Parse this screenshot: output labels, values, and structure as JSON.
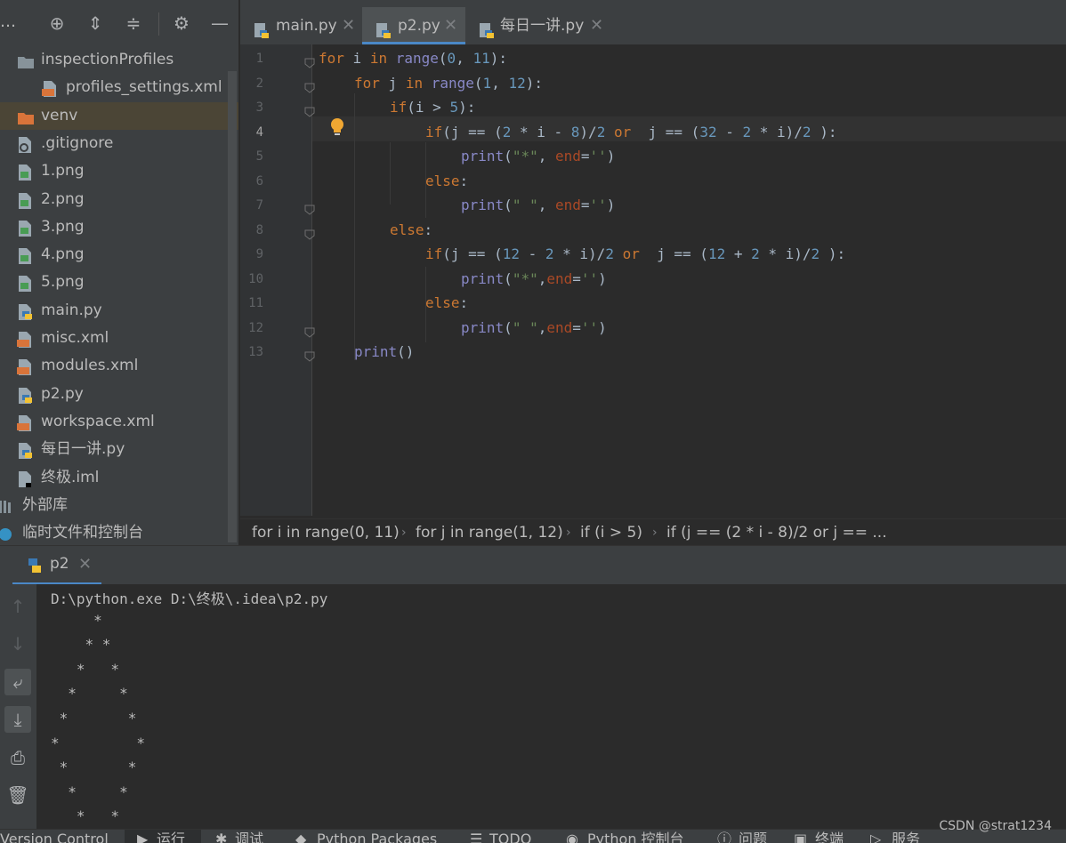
{
  "sidebar": {
    "toolbar_icons": [
      "locate-icon",
      "expand-all-icon",
      "collapse-all-icon",
      "gear-icon",
      "minimize-icon"
    ],
    "tree": [
      {
        "label": "inspectionProfiles",
        "icon": "folder-icon",
        "indent": 1
      },
      {
        "label": "profiles_settings.xml",
        "icon": "xml-file-icon",
        "indent": 2
      },
      {
        "label": "venv",
        "icon": "folder-excluded-icon",
        "indent": 1,
        "selected": true
      },
      {
        "label": ".gitignore",
        "icon": "ignore-file-icon",
        "indent": 1
      },
      {
        "label": "1.png",
        "icon": "image-file-icon",
        "indent": 1
      },
      {
        "label": "2.png",
        "icon": "image-file-icon",
        "indent": 1
      },
      {
        "label": "3.png",
        "icon": "image-file-icon",
        "indent": 1
      },
      {
        "label": "4.png",
        "icon": "image-file-icon",
        "indent": 1
      },
      {
        "label": "5.png",
        "icon": "image-file-icon",
        "indent": 1
      },
      {
        "label": "main.py",
        "icon": "python-file-icon",
        "indent": 1
      },
      {
        "label": "misc.xml",
        "icon": "xml-file-icon",
        "indent": 1
      },
      {
        "label": "modules.xml",
        "icon": "xml-file-icon",
        "indent": 1
      },
      {
        "label": "p2.py",
        "icon": "python-file-icon",
        "indent": 1
      },
      {
        "label": "workspace.xml",
        "icon": "xml-file-icon",
        "indent": 1
      },
      {
        "label": "每日一讲.py",
        "icon": "python-file-icon",
        "indent": 1
      },
      {
        "label": "终极.iml",
        "icon": "iml-file-icon",
        "indent": 1
      },
      {
        "label": "外部库",
        "icon": "library-icon",
        "indent": 0
      },
      {
        "label": "临时文件和控制台",
        "icon": "scratches-icon",
        "indent": 0
      }
    ]
  },
  "tabs": [
    {
      "label": "main.py",
      "active": false
    },
    {
      "label": "p2.py",
      "active": true
    },
    {
      "label": "每日一讲.py",
      "active": false
    }
  ],
  "editor": {
    "current_line": 4,
    "lines": [
      {
        "no": "1",
        "tokens": [
          [
            "kw",
            "for"
          ],
          [
            "",
            "i"
          ],
          [
            "kw",
            "in"
          ],
          [
            "builtin",
            "range"
          ],
          [
            "",
            "("
          ],
          [
            "num",
            "0"
          ],
          [
            "",
            ", "
          ],
          [
            "num",
            "11"
          ],
          [
            "",
            "):"
          ]
        ],
        "indent": 0
      },
      {
        "no": "2",
        "tokens": [
          [
            "kw",
            "for"
          ],
          [
            "",
            "j"
          ],
          [
            "kw",
            "in"
          ],
          [
            "builtin",
            "range"
          ],
          [
            "",
            "("
          ],
          [
            "num",
            "1"
          ],
          [
            "",
            ", "
          ],
          [
            "num",
            "12"
          ],
          [
            "",
            "):"
          ]
        ],
        "indent": 1
      },
      {
        "no": "3",
        "tokens": [
          [
            "kw",
            "if"
          ],
          [
            "",
            "(i > "
          ],
          [
            "num",
            "5"
          ],
          [
            "",
            "):"
          ]
        ],
        "indent": 2
      },
      {
        "no": "4",
        "tokens": [
          [
            "kw",
            "if"
          ],
          [
            "",
            "(j == ("
          ],
          [
            "num",
            "2"
          ],
          [
            "",
            " * i - "
          ],
          [
            "num",
            "8"
          ],
          [
            "",
            ")/"
          ],
          [
            "num",
            "2"
          ],
          [
            "",
            " "
          ],
          [
            "kw",
            "or"
          ],
          [
            "",
            " j == ("
          ],
          [
            "num",
            "32"
          ],
          [
            "",
            " - "
          ],
          [
            "num",
            "2"
          ],
          [
            "",
            " * i)/"
          ],
          [
            "num",
            "2"
          ],
          [
            "",
            " ):"
          ]
        ],
        "indent": 3
      },
      {
        "no": "5",
        "tokens": [
          [
            "builtin",
            "print"
          ],
          [
            "",
            "("
          ],
          [
            "str",
            "\"*\""
          ],
          [
            "",
            ", "
          ],
          [
            "named",
            "end"
          ],
          [
            "",
            "="
          ],
          [
            "str",
            "''"
          ],
          [
            "",
            ")"
          ]
        ],
        "indent": 4
      },
      {
        "no": "6",
        "tokens": [
          [
            "kw",
            "else"
          ],
          [
            "",
            ":"
          ]
        ],
        "indent": 3
      },
      {
        "no": "7",
        "tokens": [
          [
            "builtin",
            "print"
          ],
          [
            "",
            "("
          ],
          [
            "str",
            "\" \""
          ],
          [
            "",
            ", "
          ],
          [
            "named",
            "end"
          ],
          [
            "",
            "="
          ],
          [
            "str",
            "''"
          ],
          [
            "",
            ")"
          ]
        ],
        "indent": 4
      },
      {
        "no": "8",
        "tokens": [
          [
            "kw",
            "else"
          ],
          [
            "",
            ":"
          ]
        ],
        "indent": 2
      },
      {
        "no": "9",
        "tokens": [
          [
            "kw",
            "if"
          ],
          [
            "",
            "(j == ("
          ],
          [
            "num",
            "12"
          ],
          [
            "",
            " - "
          ],
          [
            "num",
            "2"
          ],
          [
            "",
            " * i)/"
          ],
          [
            "num",
            "2"
          ],
          [
            "",
            " "
          ],
          [
            "kw",
            "or"
          ],
          [
            "",
            " j == ("
          ],
          [
            "num",
            "12"
          ],
          [
            "",
            " + "
          ],
          [
            "num",
            "2"
          ],
          [
            "",
            " * i)/"
          ],
          [
            "num",
            "2"
          ],
          [
            "",
            " ):"
          ]
        ],
        "indent": 3
      },
      {
        "no": "10",
        "tokens": [
          [
            "builtin",
            "print"
          ],
          [
            "",
            "("
          ],
          [
            "str",
            "\"*\""
          ],
          [
            "",
            ","
          ],
          [
            "named",
            "end"
          ],
          [
            "",
            "="
          ],
          [
            "str",
            "''"
          ],
          [
            "",
            ")"
          ]
        ],
        "indent": 4
      },
      {
        "no": "11",
        "tokens": [
          [
            "kw",
            "else"
          ],
          [
            "",
            ":"
          ]
        ],
        "indent": 3
      },
      {
        "no": "12",
        "tokens": [
          [
            "builtin",
            "print"
          ],
          [
            "",
            "("
          ],
          [
            "str",
            "\" \""
          ],
          [
            "",
            ","
          ],
          [
            "named",
            "end"
          ],
          [
            "",
            "="
          ],
          [
            "str",
            "''"
          ],
          [
            "",
            ")"
          ]
        ],
        "indent": 4
      },
      {
        "no": "13",
        "tokens": [
          [
            "builtin",
            "print"
          ],
          [
            "",
            "()"
          ]
        ],
        "indent": 1
      }
    ]
  },
  "breadcrumb": [
    "for i in range(0, 11)",
    "for j in range(1, 12)",
    "if (i > 5)",
    "if (j == (2 * i - 8)/2 or j == ..."
  ],
  "run": {
    "tab_label": "p2",
    "output": [
      "D:\\python.exe D:\\终极\\.idea\\p2.py",
      "     *",
      "    * *",
      "   *   *",
      "  *     *",
      " *       *",
      "*         *",
      " *       *",
      "  *     *",
      "   *   *"
    ]
  },
  "bottombar": [
    "Version Control",
    "运行",
    "调试",
    "Python Packages",
    "TODO",
    "Python 控制台",
    "问题",
    "终端",
    "服务"
  ],
  "watermark": "CSDN @strat1234",
  "colors": {
    "keyword": "#cc7832",
    "number": "#6897bb",
    "string": "#6a8759",
    "builtin": "#8888c6",
    "accent": "#4a88c7"
  }
}
